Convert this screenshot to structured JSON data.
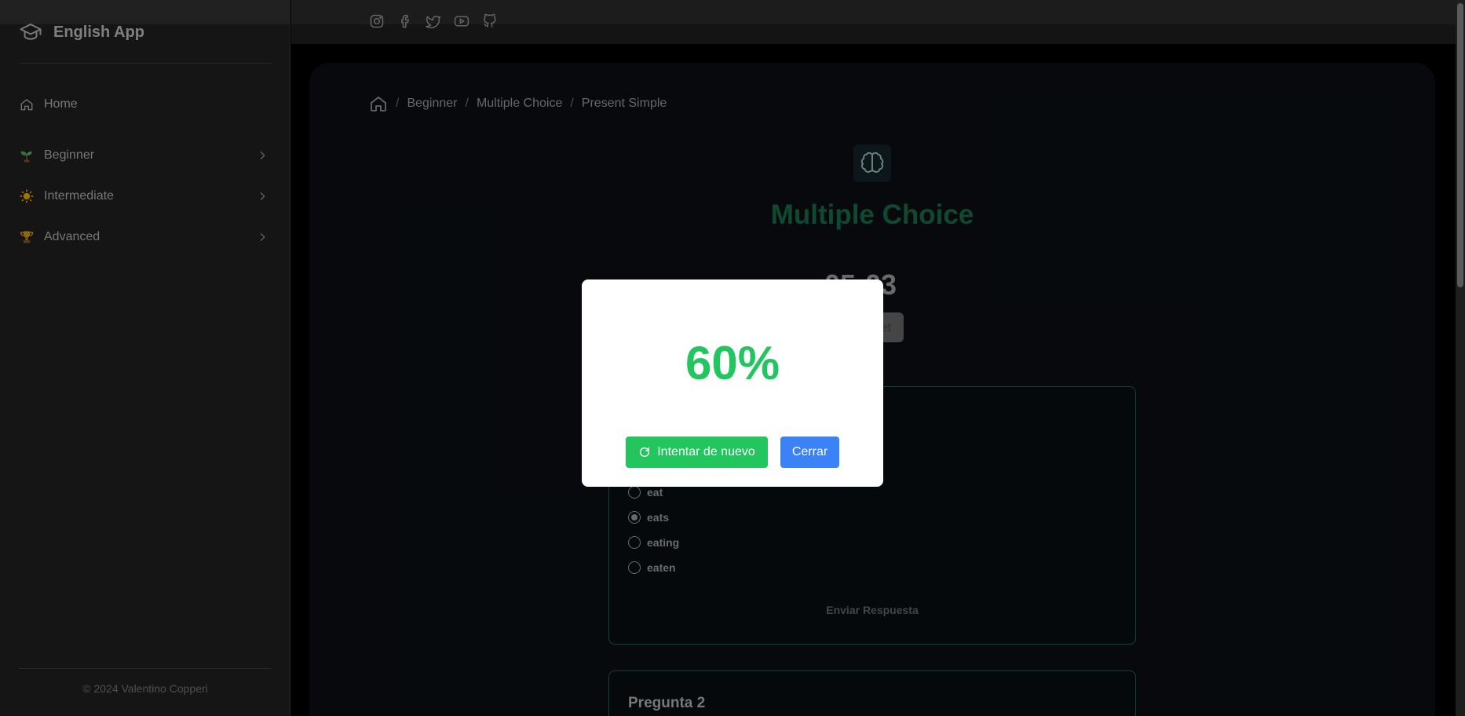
{
  "sidebar": {
    "brand": "English App",
    "items": [
      {
        "label": "Home",
        "icon": "home-icon"
      },
      {
        "label": "Beginner",
        "icon": "seedling-icon"
      },
      {
        "label": "Intermediate",
        "icon": "sun-icon"
      },
      {
        "label": "Advanced",
        "icon": "trophy-icon"
      }
    ],
    "footer": "© 2024 Valentino Copperi"
  },
  "topbar": {
    "socials": [
      "instagram-icon",
      "facebook-icon",
      "twitter-icon",
      "youtube-icon",
      "github-icon"
    ]
  },
  "breadcrumb": [
    "Beginner",
    "Multiple Choice",
    "Present Simple"
  ],
  "page": {
    "title": "Multiple Choice",
    "timer": "05:03",
    "reset_label": "et"
  },
  "questions": [
    {
      "options": [
        "eat",
        "eats",
        "eating",
        "eaten"
      ],
      "selected": "eats",
      "submit_label": "Enviar Respuesta"
    },
    {
      "title": "Pregunta 2"
    }
  ],
  "modal": {
    "score": "60%",
    "retry_label": "Intentar de nuevo",
    "close_label": "Cerrar"
  },
  "colors": {
    "accent_green": "#22c55e",
    "title_green": "#17704a",
    "button_blue": "#3b82f6"
  }
}
